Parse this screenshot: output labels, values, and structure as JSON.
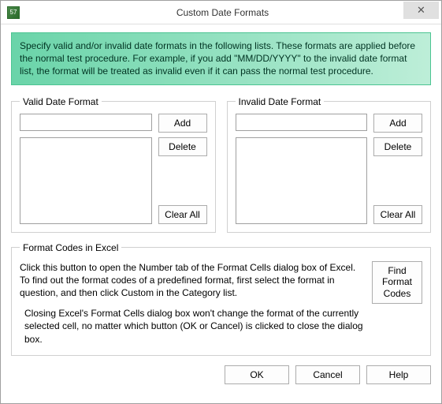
{
  "title": "Custom Date Formats",
  "banner": "Specify valid and/or invalid date formats in the following lists. These formats are applied before the normal test procedure. For example, if you add \"MM/DD/YYYY\" to the invalid date format list, the format will be treated as invalid even if it can pass the normal test procedure.",
  "valid": {
    "legend": "Valid Date Format",
    "input_value": "",
    "add": "Add",
    "delete": "Delete",
    "clear": "Clear All"
  },
  "invalid": {
    "legend": "Invalid Date Format",
    "input_value": "",
    "add": "Add",
    "delete": "Delete",
    "clear": "Clear All"
  },
  "codes": {
    "legend": "Format Codes in Excel",
    "p1": "Click this button to open the Number tab of the Format Cells dialog box of Excel. To find out the format codes of a predefined format, first select the format in question, and then click Custom in the Category list.",
    "p2": "Closing Excel's Format Cells dialog box won't change the format of the currently selected cell, no matter which button (OK or Cancel) is clicked to close the dialog box.",
    "find_btn": "Find Format Codes"
  },
  "buttons": {
    "ok": "OK",
    "cancel": "Cancel",
    "help": "Help"
  }
}
